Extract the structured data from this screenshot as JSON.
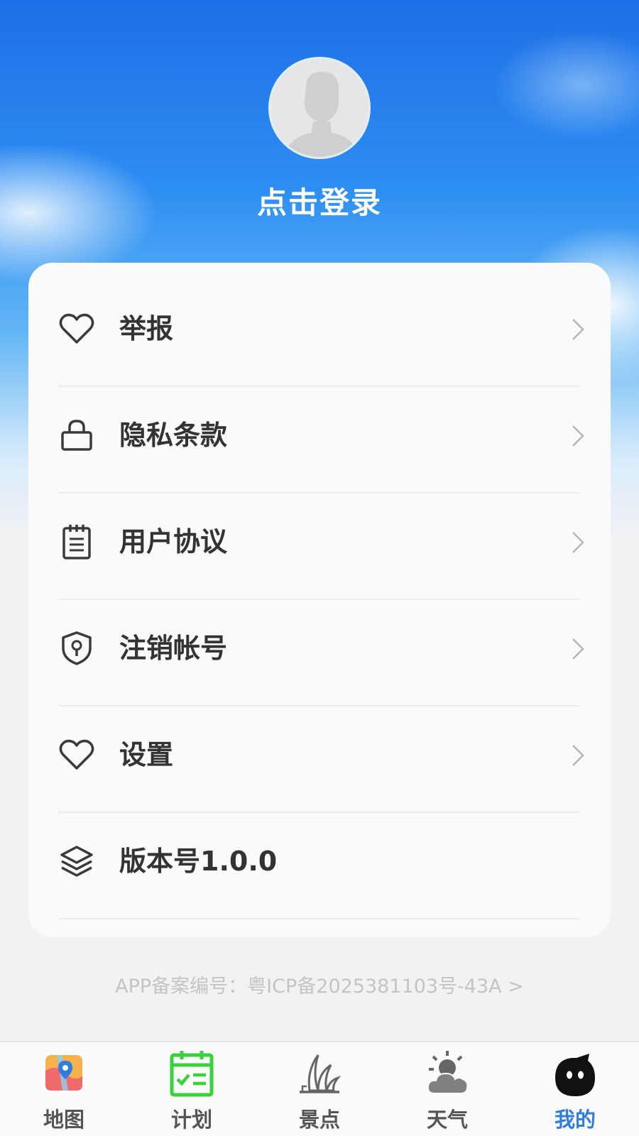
{
  "header": {
    "login_label": "点击登录",
    "avatar_icon": "default-avatar-icon"
  },
  "menu": {
    "items": [
      {
        "label": "举报",
        "icon": "heart-icon",
        "has_chevron": true
      },
      {
        "label": "隐私条款",
        "icon": "lock-icon",
        "has_chevron": true
      },
      {
        "label": "用户协议",
        "icon": "notepad-icon",
        "has_chevron": true
      },
      {
        "label": "注销帐号",
        "icon": "shield-keyhole-icon",
        "has_chevron": true
      },
      {
        "label": "设置",
        "icon": "heart-icon",
        "has_chevron": true
      },
      {
        "label": "版本号1.0.0",
        "icon": "layers-icon",
        "has_chevron": false
      }
    ]
  },
  "footer": {
    "icp_text": "APP备案编号：粤ICP备2025381103号-43A >"
  },
  "tabbar": {
    "active_index": 4,
    "active_color": "#2f7de1",
    "tabs": [
      {
        "label": "地图",
        "icon": "map-icon"
      },
      {
        "label": "计划",
        "icon": "calendar-check-icon"
      },
      {
        "label": "景点",
        "icon": "opera-house-icon"
      },
      {
        "label": "天气",
        "icon": "weather-icon"
      },
      {
        "label": "我的",
        "icon": "mascot-icon"
      }
    ]
  }
}
